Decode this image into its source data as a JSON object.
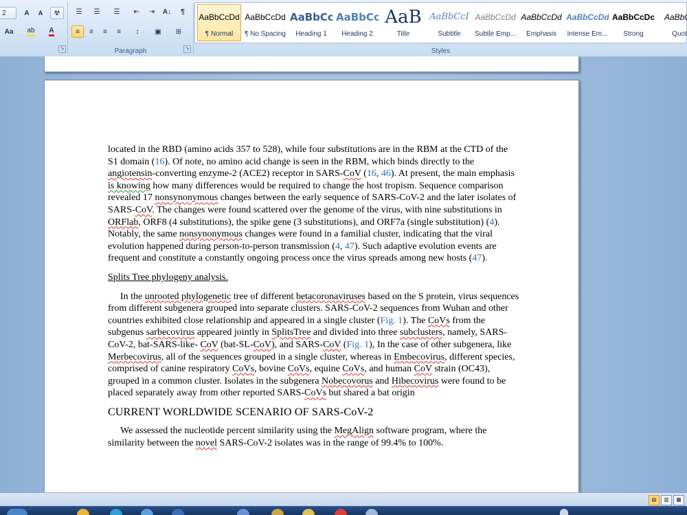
{
  "ribbon": {
    "font_row1": {
      "font_size_tail": "2",
      "grow_font": "A",
      "shrink_font": "A",
      "clear_format": "☢"
    },
    "font_row2": {
      "change_case": "Aa",
      "highlight": "ab",
      "font_color": "A"
    },
    "paragraph": {
      "label": "Paragraph",
      "bullets": "☰",
      "numbering": "☰",
      "multilevel": "☰",
      "decrease_indent": "⇤",
      "increase_indent": "⇥",
      "sort": "A↓",
      "show_marks": "¶",
      "align_left": "≡",
      "center": "≡",
      "align_right": "≡",
      "justify": "≡",
      "line_spacing": "↕",
      "shading": "▣",
      "borders": "⊞"
    },
    "styles": {
      "label": "Styles",
      "items": [
        {
          "preview": "AaBbCcDd",
          "name": "¶ Normal",
          "color": "#000000"
        },
        {
          "preview": "AaBbCcDd",
          "name": "¶ No Spacing",
          "color": "#000000"
        },
        {
          "preview": "AaBbCc",
          "name": "Heading 1",
          "color": "#365f91"
        },
        {
          "preview": "AaBbCc",
          "name": "Heading 2",
          "color": "#4f81bd"
        },
        {
          "preview": "AaB",
          "name": "Title",
          "color": "#17365d"
        },
        {
          "preview": "AaBbCcI",
          "name": "Subtitle",
          "color": "#4f81bd"
        },
        {
          "preview": "AaBbCcDd",
          "name": "Subtle Emp...",
          "color": "#7f7f7f"
        },
        {
          "preview": "AaBbCcDd",
          "name": "Emphasis",
          "color": "#000000"
        },
        {
          "preview": "AaBbCcDd",
          "name": "Intense Em...",
          "color": "#4f81bd"
        },
        {
          "preview": "AaBbCcDc",
          "name": "Strong",
          "color": "#000000"
        },
        {
          "preview": "AaBbCc",
          "name": "Quot",
          "color": "#000000"
        }
      ]
    }
  },
  "document": {
    "p1": {
      "t1": "located in the RBD (amino acids 357 to 528), while four substitutions are in the RBM at the CTD of the S1 domain (",
      "r1": "16",
      "t2": "). Of note, no amino acid change is seen in the RBM, which binds directly to the ",
      "w1": "angiotensin",
      "t3": "-converting enzyme-2 (ACE2) receptor in SARS-",
      "w2": "CoV",
      "t4": " (",
      "r2": "16",
      "t5": ", ",
      "r3": "46",
      "t6": "). At present, the main emphasis ",
      "w3": "is knowing",
      "t7": " how many differences would be required to change the host tropism. Sequence comparison revealed 17 ",
      "w4": "nonsynonymous",
      "t8": " changes between the early sequence of SARS-CoV-2 and the later isolates of SARS-",
      "w5": "CoV",
      "t9": ". The changes were found scattered over the genome of the virus, with nine substitutions in ",
      "w6": "ORFlab",
      "t10": ", ORF8 (4 substitutions), the spike gene (3 substitutions), and ORF7a (single substitution) (",
      "r4": "4",
      "t11": "). Notably, the same ",
      "w7": "nonsynonymous",
      "t12": " changes were found in a familial cluster, indicating that the viral evolution happened during person-to-person transmission (",
      "r5": "4",
      "t13": ", ",
      "r6": "47",
      "t14": "). Such adaptive evolution events are frequent and constitute a constantly ongoing process once the virus spreads among new hosts (",
      "r7": "47",
      "t15": ")."
    },
    "h1": "Splits Tree phylogeny analysis.",
    "p2": {
      "t1": "In the ",
      "w1": "unrooted phylogenetic",
      "t2": " tree of different ",
      "w2": "betacoronaviruses",
      "t3": " based on the S protein, virus sequences from different subgenera grouped into separate clusters. SARS-CoV-2 sequences from Wuhan and other countries exhibited close relationship and appeared in a single cluster (",
      "r1": "Fig. 1",
      "t4": "). The ",
      "w3": "CoVs",
      "t5": " from the subgenus ",
      "w4": "sarbecovirus",
      "t6": " appeared jointly in ",
      "w5": "SplitsTree",
      "t7": " and divided into three ",
      "w6": "subclusters",
      "t8": ", namely, SARS-CoV-2, bat-SARS-like- ",
      "w7": "CoV",
      "t9": " (bat-SL-",
      "w8": "CoV",
      "t10": "), and SARS-",
      "w9": "CoV",
      "t11": " (",
      "r2": "Fig. 1",
      "t12": "), In the case of other subgenera, like ",
      "w10": "Merbecovirus",
      "t13": ", all of the sequences grouped in a single cluster, whereas in ",
      "w11": "Embecovirus",
      "t14": ", different species, comprised of canine respiratory ",
      "w12": "CoVs",
      "t15": ", bovine ",
      "w13": "CoVs",
      "t16": ", equine ",
      "w14": "CoVs",
      "t17": ", and human ",
      "w15": "CoV",
      "t18": " strain (OC43), grouped in a common cluster. Isolates in the subgenera ",
      "w16": "Nobecovorus",
      "t19": " and ",
      "w17": "Hibecovirus",
      "t20": " were found to be placed separately away from other reported SARS-",
      "w18": "CoVs",
      "t21": " but shared a bat origin"
    },
    "h2": "CURRENT WORLDWIDE SCENARIO OF SARS-CoV-2",
    "p3": {
      "t1": "We assessed the nucleotide percent similarity using the ",
      "w1": "MegAlign",
      "t2": " software program, where the similarity between the ",
      "w2": "novel",
      "t3": " SARS-CoV-2 isolates was in the range of 99.4% to 100%."
    }
  },
  "statusbar": {
    "views": [
      "▤",
      "▥",
      "▦"
    ]
  }
}
